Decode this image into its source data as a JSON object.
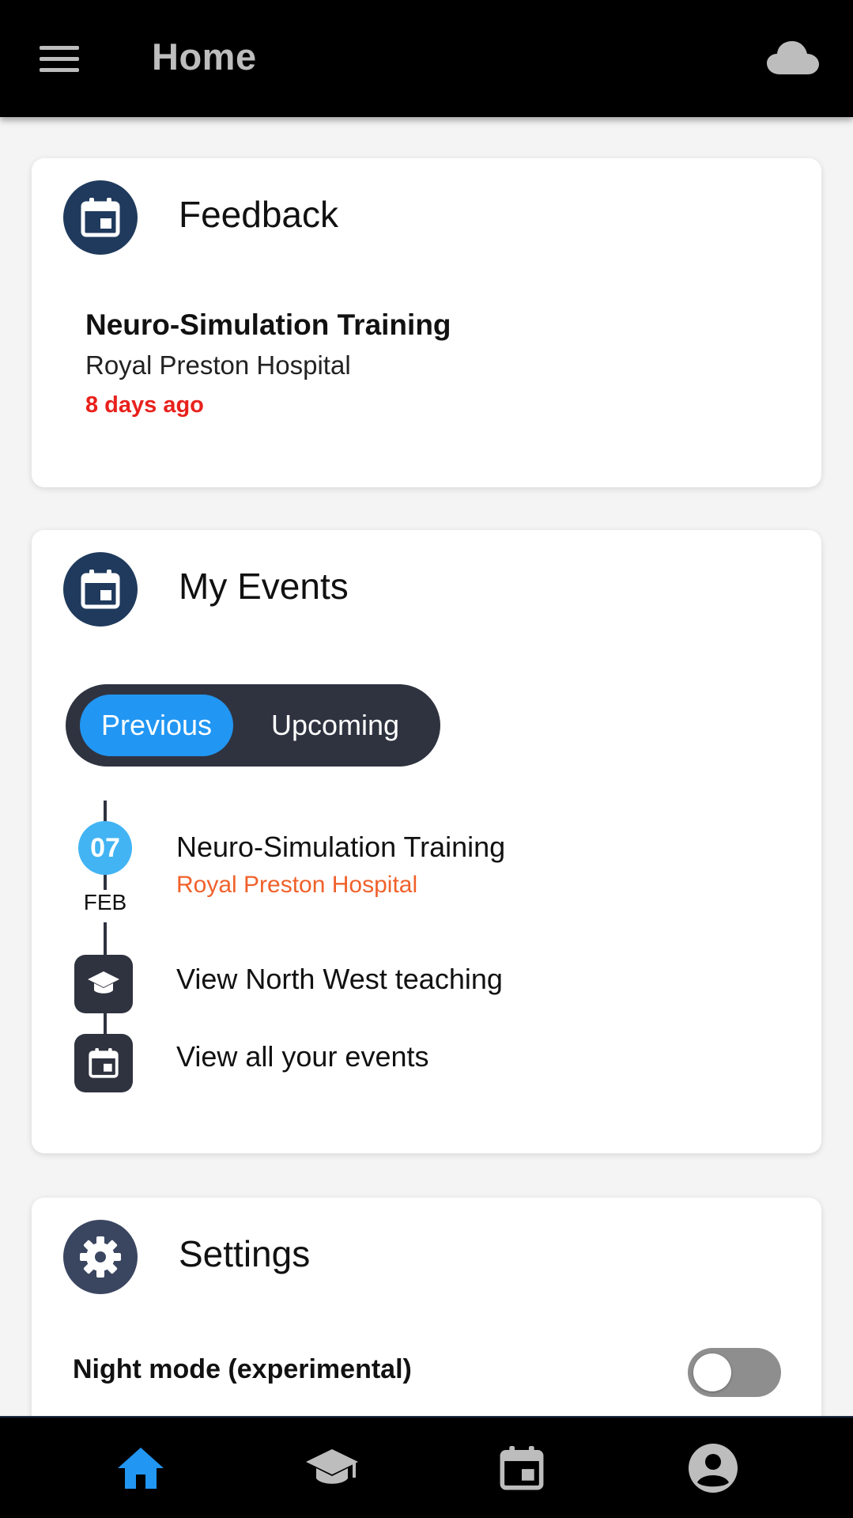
{
  "topbar": {
    "title": "Home",
    "menu_icon": "hamburger-menu-icon",
    "status_icon": "cloud-icon"
  },
  "feedback": {
    "title": "Feedback",
    "icon": "calendar-icon",
    "item": {
      "title": "Neuro-Simulation Training",
      "location": "Royal Preston Hospital",
      "time": "8 days ago"
    }
  },
  "events": {
    "title": "My Events",
    "icon": "calendar-icon",
    "tabs": [
      "Previous",
      "Upcoming"
    ],
    "selected_tab": "Previous",
    "items": [
      {
        "day": "07",
        "month": "FEB",
        "title": "Neuro-Simulation Training",
        "location": "Royal Preston Hospital"
      }
    ],
    "links": [
      {
        "label": "View North West teaching",
        "icon": "graduation-cap-icon"
      },
      {
        "label": "View all your events",
        "icon": "calendar-icon"
      }
    ]
  },
  "settings": {
    "title": "Settings",
    "icon": "gear-icon",
    "night_mode_label": "Night mode (experimental)",
    "night_mode_on": false
  },
  "bottomnav": {
    "items": [
      "home-icon",
      "graduation-cap-icon",
      "calendar-icon",
      "account-icon"
    ],
    "active": "home-icon"
  },
  "colors": {
    "accent": "#2196f3",
    "danger": "#e8211c",
    "location": "#f0612b",
    "icon_bg": "#1f3a5c",
    "dark_panel": "#2f3340"
  }
}
